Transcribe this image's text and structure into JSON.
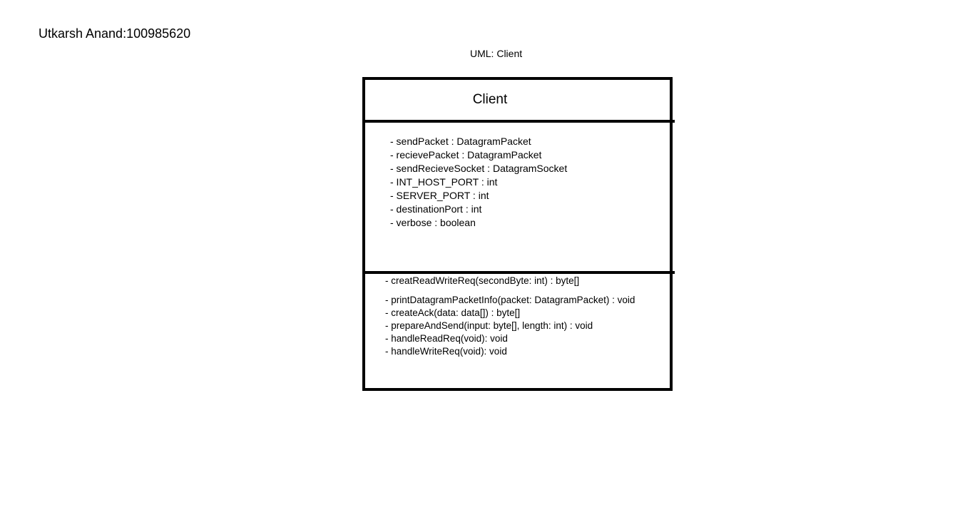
{
  "author": "Utkarsh Anand:100985620",
  "diagram_title": "UML: Client",
  "class": {
    "name": "Client",
    "attributes": [
      "- sendPacket : DatagramPacket",
      "- recievePacket : DatagramPacket",
      "- sendRecieveSocket : DatagramSocket",
      "- INT_HOST_PORT : int",
      "- SERVER_PORT : int",
      "- destinationPort : int",
      "- verbose : boolean"
    ],
    "methods": [
      "- creatReadWriteReq(secondByte: int) : byte[]",
      "- printDatagramPacketInfo(packet: DatagramPacket) : void",
      "- createAck(data: data[]) : byte[]",
      "- prepareAndSend(input: byte[], length: int) : void",
      "- handleReadReq(void): void",
      "- handleWriteReq(void): void"
    ]
  }
}
